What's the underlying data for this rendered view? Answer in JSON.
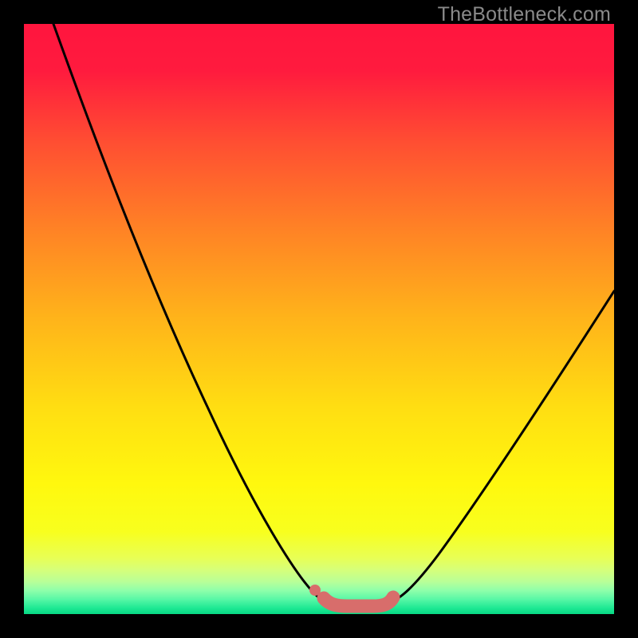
{
  "watermark": "TheBottleneck.com",
  "chart_data": {
    "type": "line",
    "title": "",
    "xlabel": "",
    "ylabel": "",
    "xlim": [
      0,
      100
    ],
    "ylim": [
      0,
      100
    ],
    "series": [
      {
        "name": "black-left-curve",
        "x": [
          5,
          10,
          15,
          20,
          25,
          30,
          35,
          40,
          45,
          49,
          52
        ],
        "values": [
          100,
          90,
          80,
          69,
          58,
          46,
          34,
          23,
          11,
          3,
          1
        ]
      },
      {
        "name": "black-right-curve",
        "x": [
          62,
          66,
          70,
          75,
          80,
          85,
          90,
          95,
          100
        ],
        "values": [
          1,
          3,
          8,
          15,
          23,
          31,
          40,
          48,
          55
        ]
      },
      {
        "name": "pink-bottleneck-band",
        "x": [
          49,
          52,
          55,
          58,
          60,
          62
        ],
        "values": [
          3,
          1,
          1,
          1,
          1,
          2
        ]
      }
    ],
    "gradient_stops": [
      {
        "pos": 0.0,
        "color": "#ff153e"
      },
      {
        "pos": 0.08,
        "color": "#ff1b3e"
      },
      {
        "pos": 0.2,
        "color": "#ff4e32"
      },
      {
        "pos": 0.35,
        "color": "#ff8325"
      },
      {
        "pos": 0.5,
        "color": "#ffb41a"
      },
      {
        "pos": 0.65,
        "color": "#ffde12"
      },
      {
        "pos": 0.78,
        "color": "#fff80e"
      },
      {
        "pos": 0.86,
        "color": "#f8ff1e"
      },
      {
        "pos": 0.905,
        "color": "#e8ff55"
      },
      {
        "pos": 0.925,
        "color": "#d6ff7a"
      },
      {
        "pos": 0.945,
        "color": "#b9ff98"
      },
      {
        "pos": 0.96,
        "color": "#8fffaa"
      },
      {
        "pos": 0.975,
        "color": "#58f7a6"
      },
      {
        "pos": 0.99,
        "color": "#1de893"
      },
      {
        "pos": 1.0,
        "color": "#08d884"
      }
    ],
    "accent_color": "#d86d6b"
  }
}
